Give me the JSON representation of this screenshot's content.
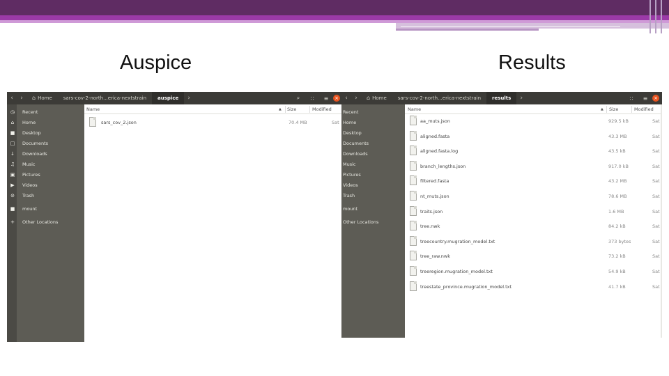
{
  "slide": {
    "left_caption": "Auspice",
    "right_caption": "Results"
  },
  "windows": {
    "left": {
      "nav": {
        "back": "‹",
        "forward": "›"
      },
      "breadcrumbs": [
        "Home",
        "sars-cov-2-north...erica-nextstrain",
        "auspice"
      ],
      "breadcrumb_more": "›",
      "toolbar": {
        "search_icon": "⌕",
        "view_icon": "∷",
        "menu_icon": "≡",
        "close_icon": "×"
      },
      "sidebar": [
        {
          "icon": "◷",
          "label": "Recent"
        },
        {
          "icon": "⌂",
          "label": "Home"
        },
        {
          "icon": "■",
          "label": "Desktop"
        },
        {
          "icon": "□",
          "label": "Documents"
        },
        {
          "icon": "↓",
          "label": "Downloads"
        },
        {
          "icon": "♫",
          "label": "Music"
        },
        {
          "icon": "▣",
          "label": "Pictures"
        },
        {
          "icon": "▶",
          "label": "Videos"
        },
        {
          "icon": "⊘",
          "label": "Trash"
        },
        {
          "icon": "■",
          "label": "mount"
        },
        {
          "icon": "+",
          "label": "Other Locations"
        }
      ],
      "columns": {
        "name": "Name",
        "size": "Size",
        "modified": "Modified",
        "sort_icon": "▲"
      },
      "files": [
        {
          "name": "sars_cov_2.json",
          "size": "70.4 MB",
          "modified": "Sat"
        }
      ]
    },
    "right": {
      "nav": {
        "back": "‹",
        "forward": "›"
      },
      "breadcrumbs": [
        "Home",
        "sars-cov-2-north...erica-nextstrain",
        "results"
      ],
      "breadcrumb_more": "›",
      "toolbar": {
        "view_icon": "∷",
        "menu_icon": "≡",
        "close_icon": "×"
      },
      "sidebar": [
        {
          "label": "Recent"
        },
        {
          "label": "Home"
        },
        {
          "label": "Desktop"
        },
        {
          "label": "Documents"
        },
        {
          "label": "Downloads"
        },
        {
          "label": "Music"
        },
        {
          "label": "Pictures"
        },
        {
          "label": "Videos"
        },
        {
          "label": "Trash"
        },
        {
          "label": "mount"
        },
        {
          "label": "Other Locations"
        }
      ],
      "columns": {
        "name": "Name",
        "size": "Size",
        "modified": "Modified",
        "sort_icon": "▲"
      },
      "files": [
        {
          "name": "aa_muts.json",
          "size": "929.5 kB",
          "modified": "Sat"
        },
        {
          "name": "aligned.fasta",
          "size": "43.3 MB",
          "modified": "Sat"
        },
        {
          "name": "aligned.fasta.log",
          "size": "43.5 kB",
          "modified": "Sat"
        },
        {
          "name": "branch_lengths.json",
          "size": "917.0 kB",
          "modified": "Sat"
        },
        {
          "name": "filtered.fasta",
          "size": "43.2 MB",
          "modified": "Sat"
        },
        {
          "name": "nt_muts.json",
          "size": "78.6 MB",
          "modified": "Sat"
        },
        {
          "name": "traits.json",
          "size": "1.6 MB",
          "modified": "Sat"
        },
        {
          "name": "tree.nwk",
          "size": "84.2 kB",
          "modified": "Sat"
        },
        {
          "name": "treecountry.mugration_model.txt",
          "size": "373 bytes",
          "modified": "Sat"
        },
        {
          "name": "tree_raw.nwk",
          "size": "73.2 kB",
          "modified": "Sat"
        },
        {
          "name": "treeregion.mugration_model.txt",
          "size": "54.9 kB",
          "modified": "Sat"
        },
        {
          "name": "treestate_province.mugration_model.txt",
          "size": "41.7 kB",
          "modified": "Sat"
        }
      ]
    }
  }
}
